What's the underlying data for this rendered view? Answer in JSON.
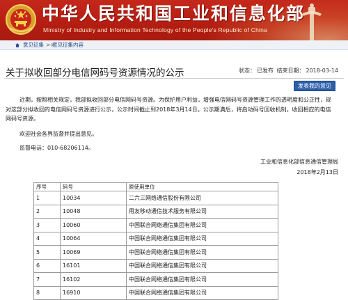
{
  "header": {
    "title": "中华人民共和国工业和信息化部",
    "subtitle": "Ministry of Industry and Information Technology of the People's Republic of China",
    "colors": {
      "banner": "#b61e12",
      "title": "#ffffff"
    }
  },
  "breadcrumb": {
    "items": [
      "意见征集",
      "意见征集内容"
    ],
    "separator": ">>"
  },
  "article": {
    "title": "关于拟收回部分电信网码号资源情况的公示",
    "status_label": "状态：",
    "status_value": "已发布",
    "deadline_label": "结束日期：",
    "deadline_value": "2018-03-14",
    "feedback_button": "发表我的意见",
    "paragraph1": "近期，按照相关规定，我部拟收回部分电信网码号资源。为保护用户利益，增强电信网码号资源管理工作的透明度和公正性，现对这部分拟收回的电信网码号资源进行公示，公示时间截止到2018年3月14日。公示期满后，将启动码号回收机制，收回相应的电信网码号资源。",
    "paragraph2": "欢迎社会各界监督并提出意见。",
    "paragraph3": "监督电话：010-68206114。",
    "signature_org": "工业和信息化部信息通信管理局",
    "signature_date": "2018年2月13日"
  },
  "table": {
    "headers": [
      "序号",
      "码号",
      "原使用单位"
    ],
    "rows": [
      [
        "1",
        "10034",
        "二六三网络通信股份有限公司"
      ],
      [
        "2",
        "10048",
        "用友移动通信技术服务有限公司"
      ],
      [
        "3",
        "10060",
        "中国联合网络通信集团有限公司"
      ],
      [
        "4",
        "10064",
        "中国联合网络通信集团有限公司"
      ],
      [
        "5",
        "10069",
        "中国联合网络通信集团有限公司"
      ],
      [
        "6",
        "16101",
        "中国联合网络通信集团有限公司"
      ],
      [
        "7",
        "16102",
        "中国联合网络通信集团有限公司"
      ],
      [
        "8",
        "16910",
        "中国联合网络通信集团有限公司"
      ]
    ]
  }
}
